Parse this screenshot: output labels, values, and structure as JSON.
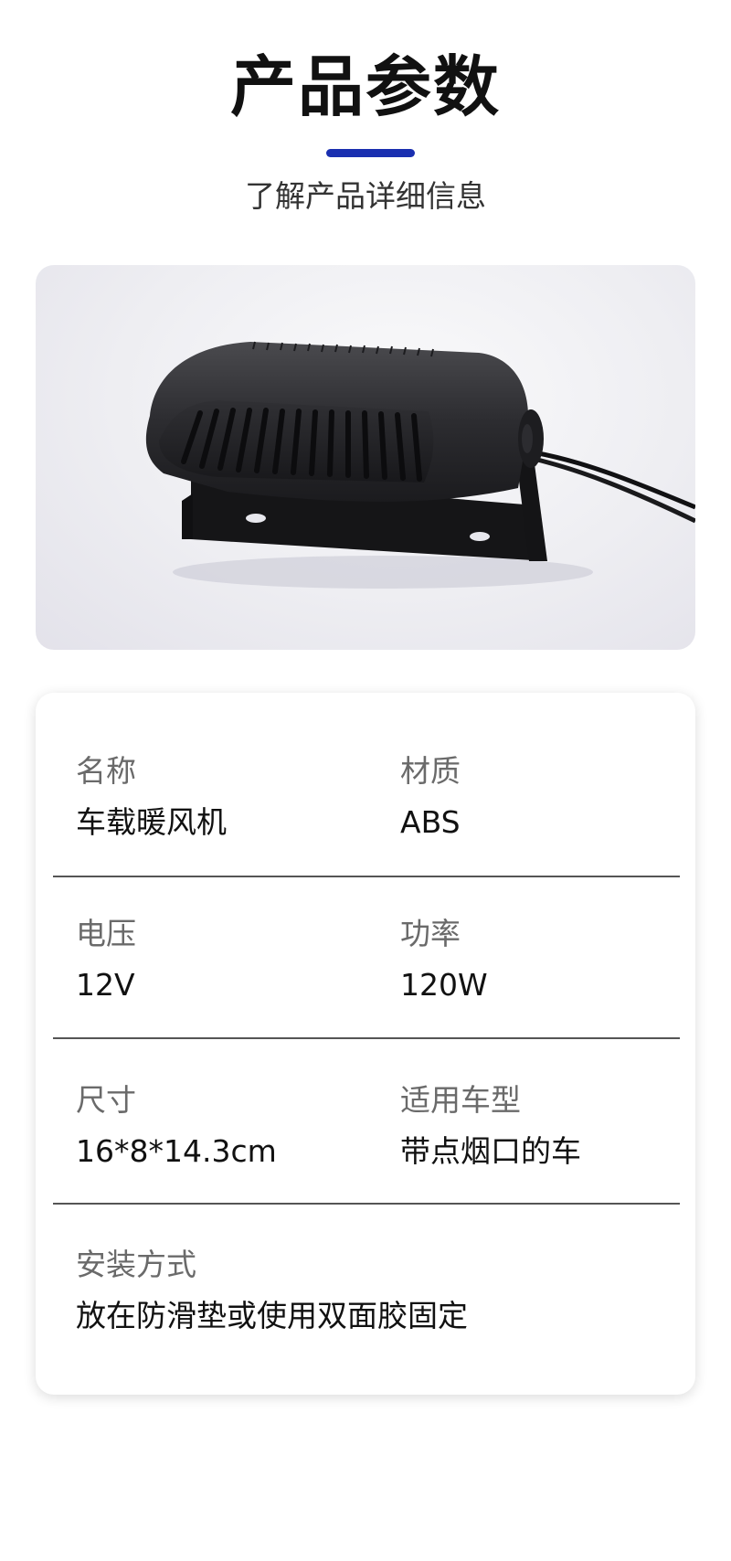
{
  "header": {
    "title": "产品参数",
    "subtitle": "了解产品详细信息",
    "accent_color": "#1a2fb0"
  },
  "product_image": {
    "subject": "black car heater with mounting bracket and power cord"
  },
  "specs": [
    {
      "label": "名称",
      "value": "车载暖风机"
    },
    {
      "label": "材质",
      "value": "ABS"
    },
    {
      "label": "电压",
      "value": "12V"
    },
    {
      "label": "功率",
      "value": "120W"
    },
    {
      "label": "尺寸",
      "value": "16*8*14.3cm"
    },
    {
      "label": "适用车型",
      "value": "带点烟口的车"
    },
    {
      "label": "安装方式",
      "value": "放在防滑垫或使用双面胶固定"
    }
  ]
}
